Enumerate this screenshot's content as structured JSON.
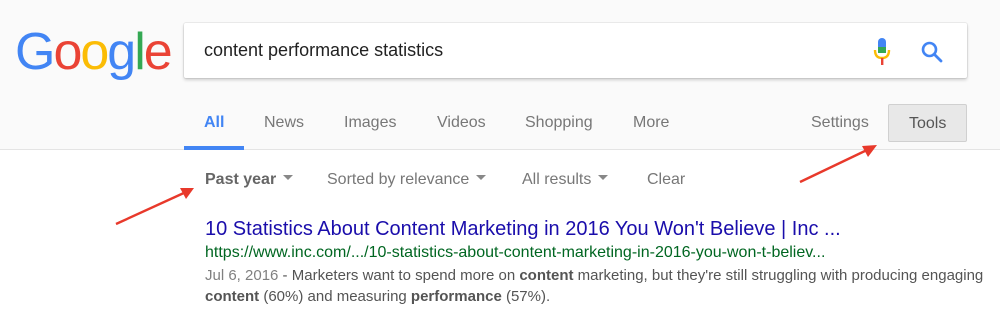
{
  "logo": {
    "letters": [
      {
        "ch": "G",
        "color": "#4285f4"
      },
      {
        "ch": "o",
        "color": "#ea4335"
      },
      {
        "ch": "o",
        "color": "#fbbc05"
      },
      {
        "ch": "g",
        "color": "#4285f4"
      },
      {
        "ch": "l",
        "color": "#34a853"
      },
      {
        "ch": "e",
        "color": "#ea4335"
      }
    ]
  },
  "search": {
    "query": "content performance statistics",
    "mic_icon": "microphone-icon",
    "search_icon": "magnifier-icon"
  },
  "tabs": {
    "all": "All",
    "news": "News",
    "images": "Images",
    "videos": "Videos",
    "shopping": "Shopping",
    "more": "More",
    "settings": "Settings",
    "tools": "Tools"
  },
  "filters": {
    "time": "Past year",
    "sort": "Sorted by relevance",
    "results": "All results",
    "clear": "Clear"
  },
  "result": {
    "title": "10 Statistics About Content Marketing in 2016 You Won't Believe | Inc ...",
    "url": "https://www.inc.com/.../10-statistics-about-content-marketing-in-2016-you-won-t-believ...",
    "date": "Jul 6, 2016",
    "sep": " - ",
    "s1": "Marketers want to spend more on ",
    "b1": "content",
    "s2": " marketing, but they're still struggling with producing engaging ",
    "b2": "content",
    "s3": " (60%) and measuring ",
    "b3": "performance",
    "s4": " (57%)."
  },
  "colors": {
    "link": "#1a0dab",
    "url": "#006621",
    "accent": "#4285f4",
    "arrow": "#e8392b"
  }
}
